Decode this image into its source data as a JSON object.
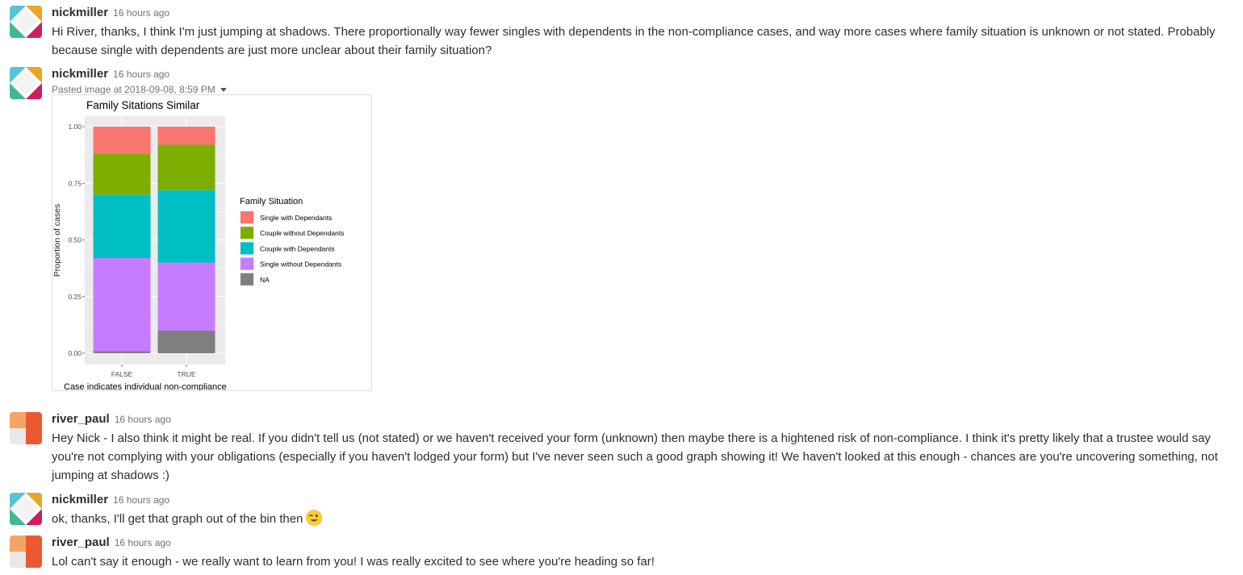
{
  "messages": [
    {
      "author": "nickmiller",
      "timestamp": "16 hours ago",
      "text": "Hi River, thanks, I think I'm just jumping at shadows.  There proportionally way fewer singles with dependents in the non-compliance cases, and way more cases where family situation is unknown or not stated.  Probably because single with dependents are just more unclear about their family situation?"
    },
    {
      "author": "nickmiller",
      "timestamp": "16 hours ago",
      "file_meta": "Pasted image at 2018-09-08, 8:59 PM"
    },
    {
      "author": "river_paul",
      "timestamp": "16 hours ago",
      "text": "Hey Nick - I also think it might be real. If you didn't tell us (not stated) or we haven't received your form (unknown) then maybe there is a hightened risk of non-compliance. I think it's pretty likely that a trustee would say you're not complying with your obligations  (especially if you haven't lodged your form) but I've never seen such a good graph showing it! We haven't looked at this enough - chances are you're uncovering something, not jumping at shadows :)"
    },
    {
      "author": "nickmiller",
      "timestamp": "16 hours ago",
      "text": "ok, thanks, I'll get that graph out of the bin then",
      "emoji": "wink-emoji"
    },
    {
      "author": "river_paul",
      "timestamp": "16 hours ago",
      "text": "Lol can't say it enough - we really want to learn from you! I was really excited to see where you're heading so far!"
    }
  ],
  "chart_data": {
    "type": "bar",
    "stacked": true,
    "title": "Family Sitations Similar",
    "xlabel": "Case indicates individual non-compliance",
    "ylabel": "Proportion of cases",
    "categories": [
      "FALSE",
      "TRUE"
    ],
    "yticks": [
      "0.00",
      "0.25",
      "0.50",
      "0.75",
      "1.00"
    ],
    "ylim": [
      0,
      1
    ],
    "legend_title": "Family Situation",
    "legend_position": "right",
    "grid": true,
    "series": [
      {
        "name": "NA",
        "color": "#7f7f7f",
        "values": [
          0.01,
          0.1
        ]
      },
      {
        "name": "Single without Dependants",
        "color": "#c77cff",
        "values": [
          0.41,
          0.3
        ]
      },
      {
        "name": "Couple with Dependants",
        "color": "#00bfc4",
        "values": [
          0.28,
          0.32
        ]
      },
      {
        "name": "Couple without Dependants",
        "color": "#7cae00",
        "values": [
          0.18,
          0.2
        ]
      },
      {
        "name": "Single with Dependants",
        "color": "#f8766d",
        "values": [
          0.12,
          0.08
        ]
      }
    ],
    "legend_order": [
      "Single with Dependants",
      "Couple without Dependants",
      "Couple with Dependants",
      "Single without Dependants",
      "NA"
    ]
  },
  "colors": {
    "author_text": "#2c2d30",
    "timestamp_text": "#717274"
  }
}
